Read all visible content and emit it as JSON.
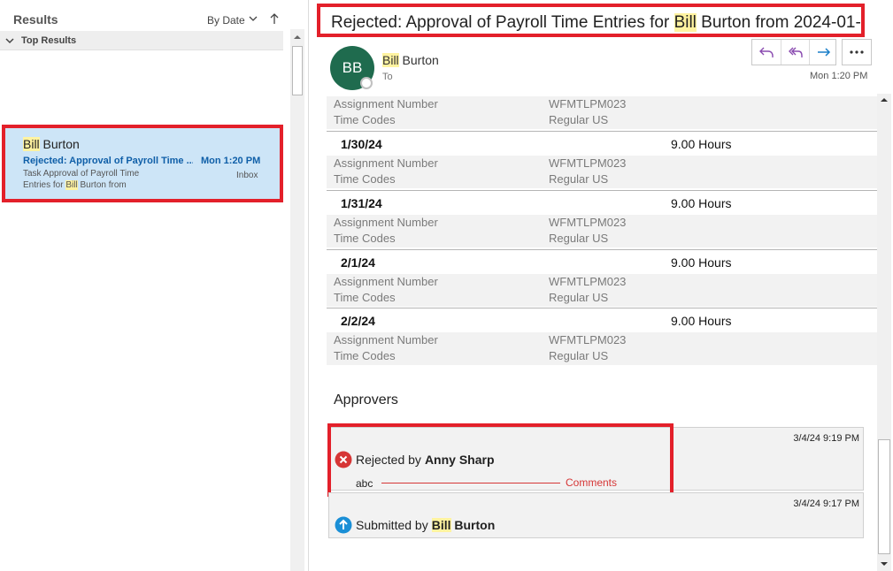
{
  "left_pane": {
    "title": "Results",
    "sort_label": "By Date",
    "group_label": "Top Results"
  },
  "mail_item": {
    "sender_first": "Bill",
    "sender_rest": " Burton",
    "subject": "Rejected: Approval of Payroll Time ...",
    "time": "Mon 1:20 PM",
    "preview_line1": "Task Approval of Payroll Time",
    "preview_line2_a": "Entries for ",
    "preview_line2_hl": "Bill",
    "preview_line2_b": " Burton from",
    "folder": "Inbox"
  },
  "reading": {
    "subject_a": "Rejected: Approval of Payroll Time Entries for ",
    "subject_hl": "Bill",
    "subject_b": " Burton from 2024-01-...",
    "avatar_initials": "BB",
    "from_first": "Bill",
    "from_rest": " Burton",
    "to_label": "To",
    "time": "Mon 1:20 PM"
  },
  "entries": {
    "top_block": {
      "k1": "Assignment Number",
      "v1": "WFMTLPM023",
      "k2": "Time Codes",
      "v2": "Regular US"
    },
    "rows": [
      {
        "date": "1/30/24",
        "hours": "9.00 Hours",
        "k1": "Assignment Number",
        "v1": "WFMTLPM023",
        "k2": "Time Codes",
        "v2": "Regular US"
      },
      {
        "date": "1/31/24",
        "hours": "9.00 Hours",
        "k1": "Assignment Number",
        "v1": "WFMTLPM023",
        "k2": "Time Codes",
        "v2": "Regular US"
      },
      {
        "date": "2/1/24",
        "hours": "9.00 Hours",
        "k1": "Assignment Number",
        "v1": "WFMTLPM023",
        "k2": "Time Codes",
        "v2": "Regular US"
      },
      {
        "date": "2/2/24",
        "hours": "9.00 Hours",
        "k1": "Assignment Number",
        "v1": "WFMTLPM023",
        "k2": "Time Codes",
        "v2": "Regular US"
      }
    ]
  },
  "approvers": {
    "title": "Approvers",
    "items": [
      {
        "timestamp": "3/4/24 9:19 PM",
        "action": "Rejected by ",
        "name": "Anny Sharp",
        "comment": "abc",
        "comments_label": "Comments"
      },
      {
        "timestamp": "3/4/24 9:17 PM",
        "action": "Submitted by ",
        "name_hl": "Bill",
        "name_rest": " Burton"
      }
    ]
  },
  "colors": {
    "accent_blue": "#0f5fa8",
    "selection_bg": "#cde5f7",
    "highlight_red": "#e3202a",
    "avatar_green": "#1f6b4e",
    "reject_red": "#d63636",
    "submit_blue": "#1a8fd6"
  },
  "icons": {
    "sort": "chevron-down-icon",
    "sort_direction": "arrow-up-icon",
    "reply": "reply-icon",
    "reply_all": "reply-all-icon",
    "forward": "forward-icon",
    "more": "more-icon",
    "rejected": "reject-icon",
    "submitted": "submit-icon"
  }
}
